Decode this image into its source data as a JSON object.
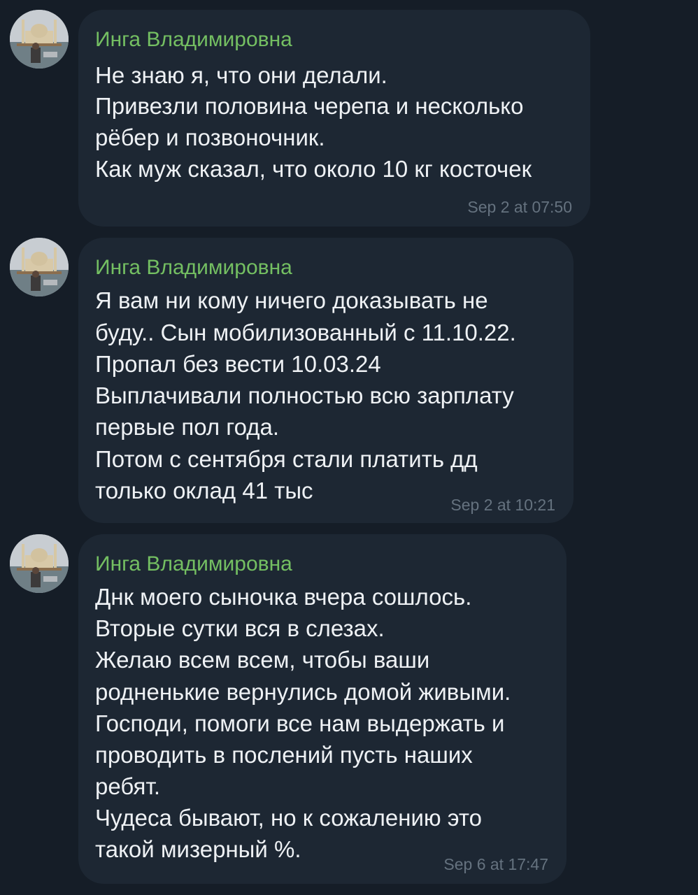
{
  "colors": {
    "background": "#151d27",
    "bubble": "#1d2733",
    "sender_name": "#74bf62",
    "message_text": "#eef1f4",
    "timestamp": "#65727f"
  },
  "messages": [
    {
      "sender": "Инга Владимировна",
      "avatar_icon": "mosque-photo-avatar",
      "lines": [
        "Не знаю я, что они делали.",
        "Привезли половина черепа и  несколько",
        "рёбер и позвоночник.",
        "Как муж сказал, что около 10 кг косточек"
      ],
      "time": "Sep 2 at 07:50"
    },
    {
      "sender": "Инга Владимировна",
      "avatar_icon": "mosque-photo-avatar",
      "lines": [
        "Я вам ни кому ничего доказывать не",
        "буду.. Сын мобилизованный с 11.10.22.",
        "Пропал без вести 10.03.24",
        "Выплачивали полностью всю зарплату",
        "первые пол года.",
        "Потом с сентября стали платить дд",
        "только оклад 41 тыс"
      ],
      "time": "Sep 2 at 10:21"
    },
    {
      "sender": "Инга Владимировна",
      "avatar_icon": "mosque-photo-avatar",
      "lines": [
        "Днк моего сыночка вчера сошлось.",
        "Вторые сутки вся в слезах.",
        "Желаю всем  всем, чтобы ваши",
        "родненькие вернулись домой живыми.",
        "Господи, помоги все нам выдержать и",
        "проводить в послений пусть наших",
        "ребят.",
        "Чудеса бывают, но к сожалению это",
        "такой мизерный %."
      ],
      "time": "Sep 6 at 17:47"
    }
  ]
}
